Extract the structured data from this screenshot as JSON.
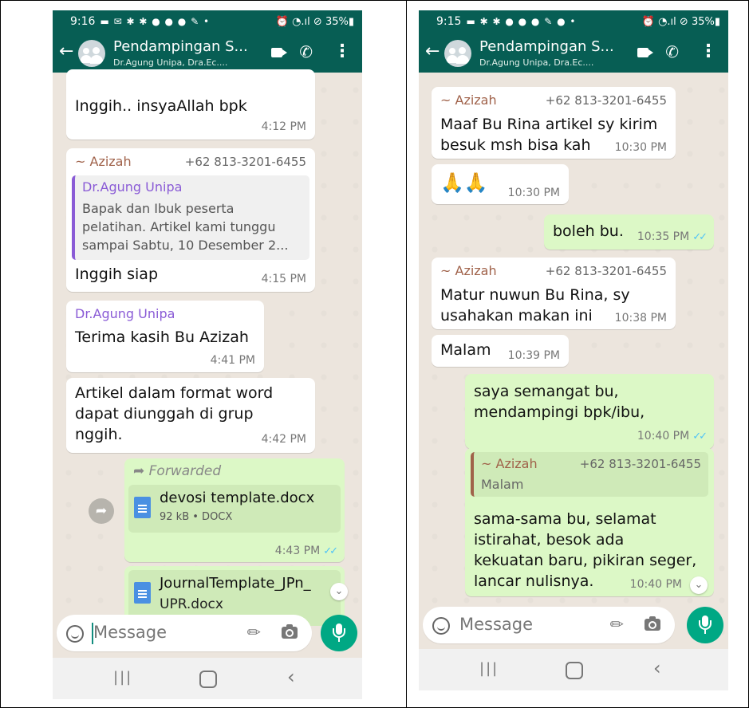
{
  "chat": {
    "title": "Pendampingan S...",
    "subtitle": "Dr.Agung Unipa, Dra.Ec...."
  },
  "left_screen": {
    "status": {
      "time": "9:16",
      "icons": "▬ ✉ ✱ ✱ ● ● ● ✎ •",
      "right": "⏰ ◔.ıl ⊘ 35%▮"
    },
    "messages": {
      "m0_text": "Inggih.. insyaAllah bpk",
      "m0_time": "4:12 PM",
      "m1_sender": "~ Azizah",
      "m1_phone": "+62 813-3201-6455",
      "m1_quote_author": "Dr.Agung Unipa",
      "m1_quote_lines": [
        "Bapak dan Ibuk peserta",
        "pelatihan. Artikel kami tunggu",
        "sampai Sabtu, 10 Desember 2..."
      ],
      "m1_text": "Inggih siap",
      "m1_time": "4:15 PM",
      "m2_sender": "Dr.Agung Unipa",
      "m2_text": "Terima kasih Bu Azizah",
      "m2_time": "4:41 PM",
      "m3_lines": [
        "Artikel dalam format word",
        "dapat diunggah di grup",
        "nggih."
      ],
      "m3_time": "4:42 PM",
      "m4_forwarded": "Forwarded",
      "m4_file_name": "devosi template.docx",
      "m4_file_meta": "92 kB • DOCX",
      "m4_time": "4:43 PM",
      "m5_file_name": "JournalTemplate_JPn_",
      "m5_file_name2": "UPR.docx"
    },
    "input_placeholder": "Message"
  },
  "right_screen": {
    "status": {
      "time": "9:15",
      "icons": "▬ ✱ ✱ ● ● ● ✎ ● •",
      "right": "⏰ ◔.ıl ⊘ 35%▮"
    },
    "messages": {
      "r0_sender": "~ Azizah",
      "r0_phone": "+62 813-3201-6455",
      "r0_lines": [
        "Maaf Bu Rina artikel sy kirim",
        "besuk msh bisa kah"
      ],
      "r0_time": "10:30 PM",
      "r1_emoji": "🙏🙏",
      "r1_time": "10:30 PM",
      "r2_text": "boleh bu.",
      "r2_time": "10:35 PM",
      "r3_sender": "~ Azizah",
      "r3_phone": "+62 813-3201-6455",
      "r3_lines": [
        "Matur nuwun Bu Rina, sy",
        "usahakan makan ini"
      ],
      "r3_time": "10:38 PM",
      "r4_text": "Malam",
      "r4_time": "10:39 PM",
      "r5_lines": [
        "saya semangat bu,",
        "mendampingi bpk/ibu,"
      ],
      "r5_time": "10:40 PM",
      "r6_quote_author": "~ Azizah",
      "r6_quote_phone": "+62 813-3201-6455",
      "r6_quote_text": "Malam",
      "r6_lines": [
        "sama-sama bu, selamat",
        "istirahat, besok ada",
        "kekuatan baru, pikiran seger,",
        "lancar nulisnya."
      ],
      "r6_time": "10:40 PM"
    },
    "input_placeholder": "Message"
  },
  "icons": {
    "back": "arrow-left-icon",
    "video": "video-call-icon",
    "call": "phone-icon",
    "menu": "more-vert-icon",
    "emoji": "emoji-icon",
    "attach": "paperclip-icon",
    "camera": "camera-icon",
    "mic": "mic-icon",
    "forward": "forward-icon",
    "doc": "document-icon",
    "scroll": "chevron-down-icon"
  },
  "colors": {
    "header": "#075e54",
    "outgoing_bubble": "#dcf8c6",
    "incoming_bubble": "#ffffff",
    "chat_bg": "#ece5dd",
    "accent": "#00a884",
    "read_ticks": "#4fc3f7"
  }
}
